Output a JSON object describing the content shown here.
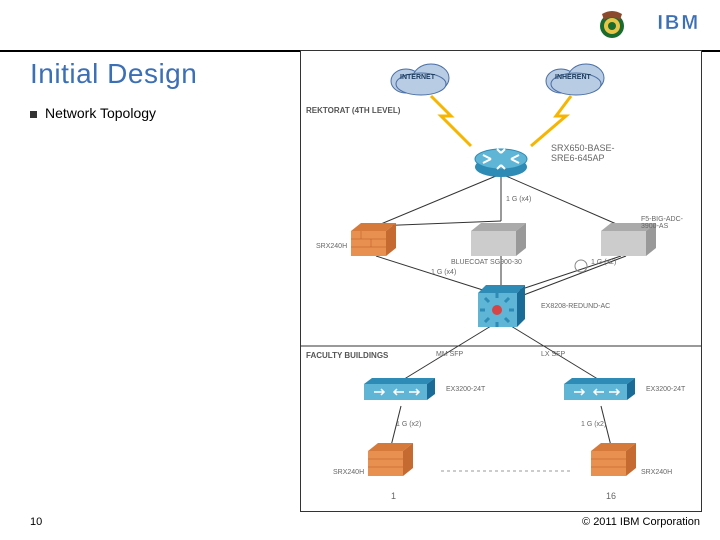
{
  "header": {
    "ibm_logo_text": "IBM"
  },
  "title": "Initial Design",
  "bullet": "Network Topology",
  "diagram": {
    "section_top": "REKTORAT (4TH LEVEL)",
    "section_bottom": "FACULTY BUILDINGS",
    "cloud_left": "INTERNET",
    "cloud_right": "INHERENT",
    "router_label": "SRX650-BASE-SRE6-645AP",
    "link_router_down": "1 G (x4)",
    "box_left": "SRX240H",
    "box_mid": "BLUECOAT SG900-30",
    "box_right": "F5-BIG-ADC-3900-AS",
    "link_mid_down": "1 G (x4)",
    "link_right_down": "1 G (x2)",
    "core_switch": "EX8208-REDUND-AC",
    "link_fac_left": "MM SFP",
    "link_fac_right": "LX SFP",
    "fac_switch_left": "EX3200-24T",
    "fac_switch_right": "EX3200-24T",
    "link_srx_left": "1 G (x2)",
    "link_srx_right": "1 G (x2)",
    "fac_fw_left": "SRX240H",
    "fac_fw_right": "SRX240H",
    "num_left": "1",
    "num_right": "16"
  },
  "footer": {
    "page": "10",
    "copyright": "© 2011 IBM Corporation"
  }
}
